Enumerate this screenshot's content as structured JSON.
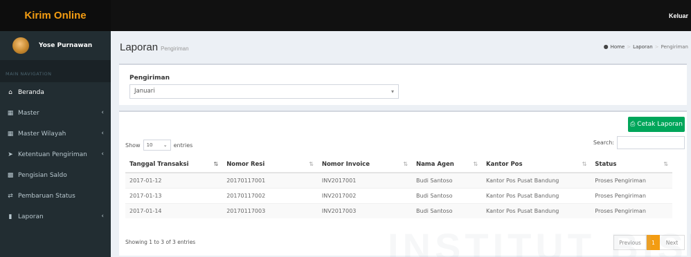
{
  "header": {
    "brand": "Kirim Online",
    "logout_label": "Keluar"
  },
  "sidebar": {
    "user_name": "Yose Purnawan",
    "nav_header": "MAIN NAVIGATION",
    "items": [
      {
        "label": "Beranda",
        "icon": "home-icon"
      },
      {
        "label": "Master",
        "icon": "table-icon"
      },
      {
        "label": "Master Wilayah",
        "icon": "map-icon"
      },
      {
        "label": "Ketentuan Pengiriman",
        "icon": "send-icon"
      },
      {
        "label": "Pengisian Saldo",
        "icon": "credit-card-icon"
      },
      {
        "label": "Pembaruan Status",
        "icon": "exchange-icon"
      },
      {
        "label": "Laporan",
        "icon": "folder-icon"
      }
    ]
  },
  "content_header": {
    "title": "Laporan",
    "subtitle": "Pengiriman",
    "breadcrumb": [
      "Home",
      "Laporan",
      "Pengiriman"
    ]
  },
  "filter": {
    "label": "Pengiriman",
    "selected": "Januari"
  },
  "report": {
    "print_label": "Cetak Laporan",
    "show_label": "Show",
    "entries_value": "10",
    "entries_label": "entries",
    "search_label": "Search:",
    "columns": [
      "Tanggal Transaksi",
      "Nomor Resi",
      "Nomor Invoice",
      "Nama Agen",
      "Kantor Pos",
      "Status"
    ],
    "rows": [
      [
        "2017-01-12",
        "20170117001",
        "INV2017001",
        "Budi Santoso",
        "Kantor Pos Pusat Bandung",
        "Proses Pengiriman"
      ],
      [
        "2017-01-13",
        "20170117002",
        "INV2017002",
        "Budi Santoso",
        "Kantor Pos Pusat Bandung",
        "Proses Pengiriman"
      ],
      [
        "2017-01-14",
        "20170117003",
        "INV2017003",
        "Budi Santoso",
        "Kantor Pos Pusat Bandung",
        "Proses Pengiriman"
      ]
    ],
    "info": "Showing 1 to 3 of 3 entries",
    "pagination": {
      "previous": "Previous",
      "current": "1",
      "next": "Next"
    }
  },
  "watermark": "INSTITUT BISNIS",
  "colors": {
    "brand": "#f39c12",
    "sidebar": "#222d32",
    "success": "#00a65a",
    "topbar": "#111111"
  }
}
